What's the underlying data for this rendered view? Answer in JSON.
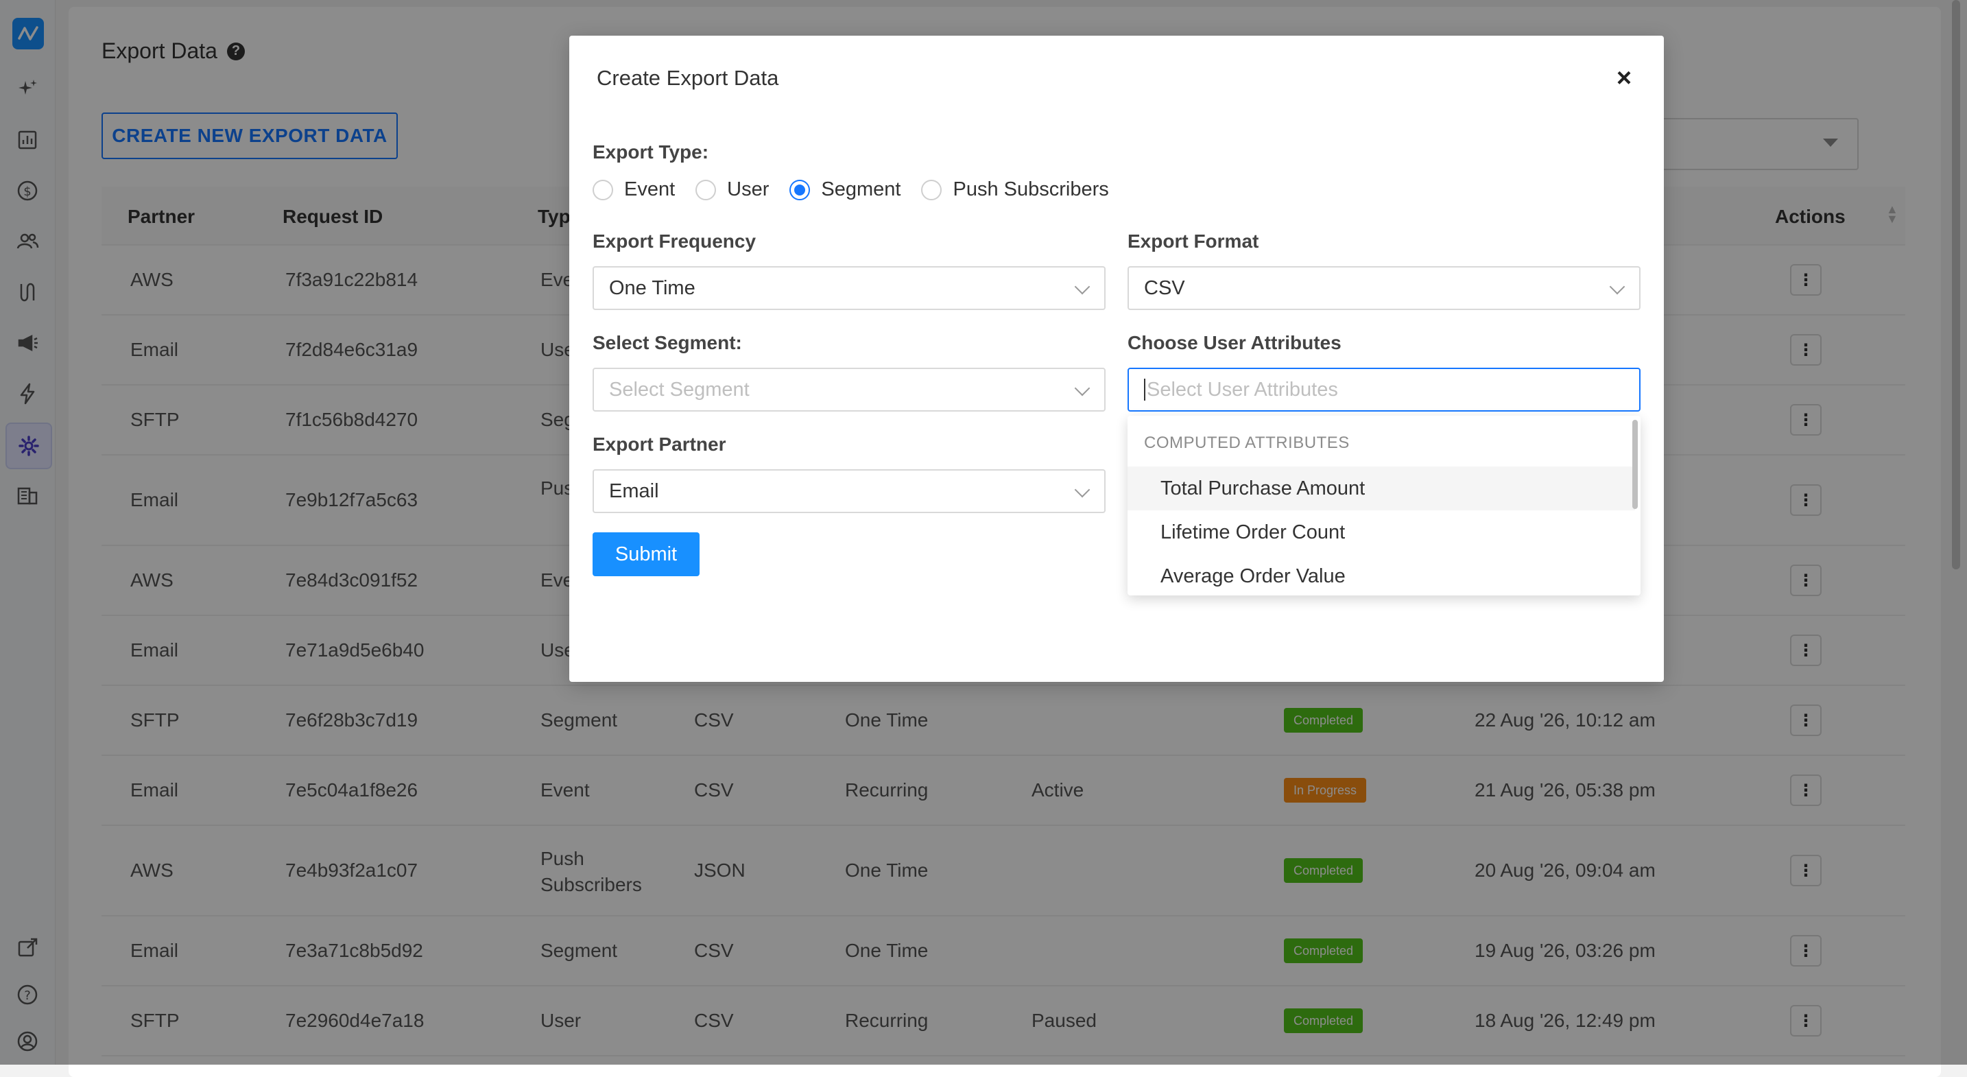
{
  "page": {
    "title": "Export Data",
    "create_button": "CREATE NEW EXPORT DATA"
  },
  "table": {
    "headers": [
      "Partner",
      "Request ID",
      "Typ",
      "Actions"
    ],
    "rows": [
      {
        "partner": "AWS",
        "request_id": "7f3a91c22b814",
        "type": "Eve",
        "format": "",
        "frequency": "",
        "state": "",
        "status": "",
        "date": ""
      },
      {
        "partner": "Email",
        "request_id": "7f2d84e6c31a9",
        "type": "Use",
        "format": "",
        "frequency": "",
        "state": "",
        "status": "",
        "date": ""
      },
      {
        "partner": "SFTP",
        "request_id": "7f1c56b8d4270",
        "type": "Seg",
        "format": "",
        "frequency": "",
        "state": "",
        "status": "",
        "date": ""
      },
      {
        "partner": "Email",
        "request_id": "7e9b12f7a5c63",
        "type": "Push Sub",
        "format": "",
        "frequency": "",
        "state": "",
        "status": "",
        "date": ""
      },
      {
        "partner": "AWS",
        "request_id": "7e84d3c091f52",
        "type": "Eve",
        "format": "",
        "frequency": "",
        "state": "",
        "status": "",
        "date": ""
      },
      {
        "partner": "Email",
        "request_id": "7e71a9d5e6b40",
        "type": "Use",
        "format": "",
        "frequency": "",
        "state": "",
        "status": "",
        "date": ""
      },
      {
        "partner": "SFTP",
        "request_id": "7e6f28b3c7d19",
        "type": "Segment",
        "format": "CSV",
        "frequency": "One Time",
        "state": "",
        "status": "Completed",
        "date": "22 Aug '26, 10:12 am"
      },
      {
        "partner": "Email",
        "request_id": "7e5c04a1f8e26",
        "type": "Event",
        "format": "CSV",
        "frequency": "Recurring",
        "state": "Active",
        "status": "In Progress",
        "date": "21 Aug '26, 05:38 pm"
      },
      {
        "partner": "AWS",
        "request_id": "7e4b93f2a1c07",
        "type": "Push Subscribers",
        "format": "JSON",
        "frequency": "One Time",
        "state": "",
        "status": "Completed",
        "date": "20 Aug '26, 09:04 am"
      },
      {
        "partner": "Email",
        "request_id": "7e3a71c8b5d92",
        "type": "Segment",
        "format": "CSV",
        "frequency": "One Time",
        "state": "",
        "status": "Completed",
        "date": "19 Aug '26, 03:26 pm"
      },
      {
        "partner": "SFTP",
        "request_id": "7e2960d4e7a18",
        "type": "User",
        "format": "CSV",
        "frequency": "Recurring",
        "state": "Paused",
        "status": "Completed",
        "date": "18 Aug '26, 12:49 pm"
      }
    ]
  },
  "modal": {
    "title": "Create Export Data",
    "close": "×",
    "export_type_label": "Export Type:",
    "export_types": [
      {
        "label": "Event",
        "checked": false
      },
      {
        "label": "User",
        "checked": false
      },
      {
        "label": "Segment",
        "checked": true
      },
      {
        "label": "Push Subscribers",
        "checked": false
      }
    ],
    "frequency_label": "Export Frequency",
    "frequency_value": "One Time",
    "format_label": "Export Format",
    "format_value": "CSV",
    "segment_label": "Select Segment:",
    "segment_placeholder": "Select Segment",
    "attributes_label": "Choose User Attributes",
    "attributes_placeholder": "Select User Attributes",
    "partner_label": "Export Partner",
    "partner_value": "Email",
    "submit": "Submit",
    "dropdown": {
      "group": "COMPUTED ATTRIBUTES",
      "items": [
        "Total Purchase Amount",
        "Lifetime Order Count",
        "Average Order Value"
      ]
    }
  },
  "icons": {
    "logo": "pulse-logo-icon",
    "nav": [
      "sparkles-icon",
      "chart-icon",
      "dollar-icon",
      "users-icon",
      "journey-icon",
      "megaphone-icon",
      "bolt-icon",
      "settings-icon",
      "building-icon"
    ],
    "bottom": [
      "external-link-icon",
      "help-icon",
      "account-icon"
    ]
  },
  "colors": {
    "primary": "#1890ff",
    "completed": "#52c41a",
    "in_progress": "#fa8c16"
  }
}
